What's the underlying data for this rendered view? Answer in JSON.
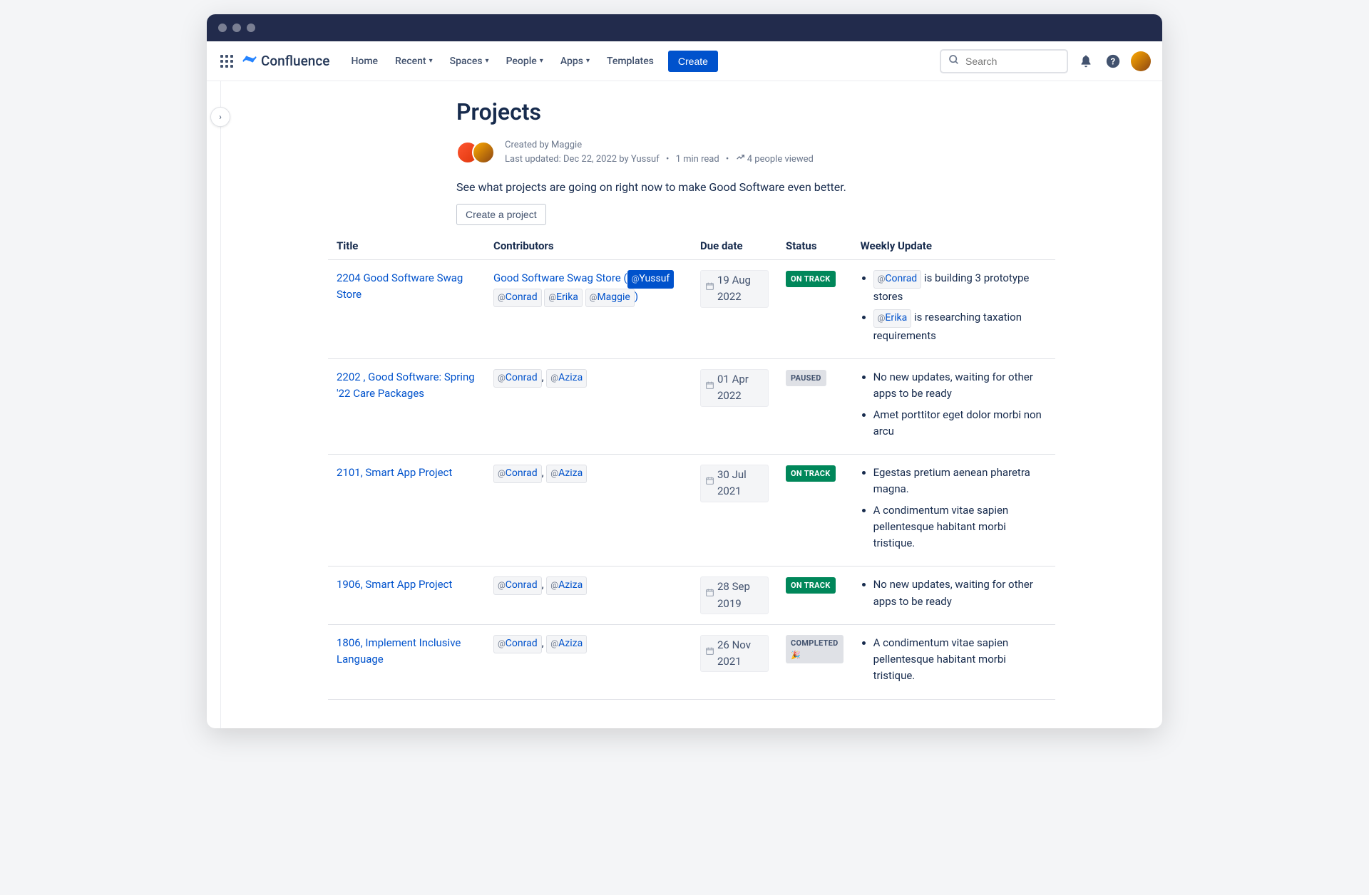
{
  "nav": {
    "logo": "Confluence",
    "items": [
      "Home",
      "Recent",
      "Spaces",
      "People",
      "Apps",
      "Templates"
    ],
    "dropdowns": [
      false,
      true,
      true,
      true,
      true,
      false
    ],
    "create": "Create",
    "search_placeholder": "Search"
  },
  "page": {
    "title": "Projects",
    "created_by": "Created by Maggie",
    "updated_line": "Last updated: Dec 22, 2022 by Yussuf",
    "read_time": "1 min read",
    "viewed": "4 people viewed",
    "intro": "See what projects are going on right now to make Good Software even better.",
    "create_project": "Create a project"
  },
  "columns": {
    "title": "Title",
    "contributors": "Contributors",
    "due": "Due date",
    "status": "Status",
    "weekly": "Weekly Update"
  },
  "rows": [
    {
      "title": "2204 Good Software Swag Store",
      "contrib_prefix": "Good Software Swag Store (",
      "contrib_suffix": ")",
      "mentions": [
        {
          "name": "Yussuf",
          "highlight": true
        },
        {
          "name": "Conrad",
          "highlight": false
        },
        {
          "name": "Erika",
          "highlight": false
        },
        {
          "name": "Maggie",
          "highlight": false
        }
      ],
      "due": "19 Aug 2022",
      "status": {
        "label": "ON TRACK",
        "class": "status-on-track"
      },
      "updates": [
        {
          "mention": "Conrad",
          "text_after": " is building 3 prototype stores"
        },
        {
          "mention": "Erika",
          "text_after": " is researching taxation requirements"
        }
      ]
    },
    {
      "title": "2202 , Good Software: Spring '22 Care Packages",
      "mentions_simple": [
        "Conrad",
        "Aziza"
      ],
      "due": "01 Apr 2022",
      "status": {
        "label": "PAUSED",
        "class": "status-paused"
      },
      "updates_plain": [
        "No new updates, waiting for other apps to be ready",
        "Amet porttitor eget dolor morbi non arcu"
      ]
    },
    {
      "title": "2101, Smart App Project",
      "mentions_simple": [
        "Conrad",
        "Aziza"
      ],
      "due": "30 Jul 2021",
      "status": {
        "label": "ON TRACK",
        "class": "status-on-track"
      },
      "updates_plain": [
        "Egestas pretium aenean pharetra magna.",
        "A condimentum vitae sapien pellentesque habitant morbi tristique."
      ]
    },
    {
      "title": "1906, Smart App Project",
      "mentions_simple": [
        "Conrad",
        "Aziza"
      ],
      "due": "28 Sep 2019",
      "status": {
        "label": "ON TRACK",
        "class": "status-on-track"
      },
      "updates_plain": [
        "No new updates, waiting for other apps to be ready"
      ]
    },
    {
      "title": "1806, Implement Inclusive Language",
      "mentions_simple": [
        "Conrad",
        "Aziza"
      ],
      "due": "26 Nov 2021",
      "status": {
        "label": "COMPLETED 🎉",
        "class": "status-completed"
      },
      "updates_plain": [
        "A condimentum vitae sapien pellentesque habitant morbi tristique."
      ]
    }
  ]
}
